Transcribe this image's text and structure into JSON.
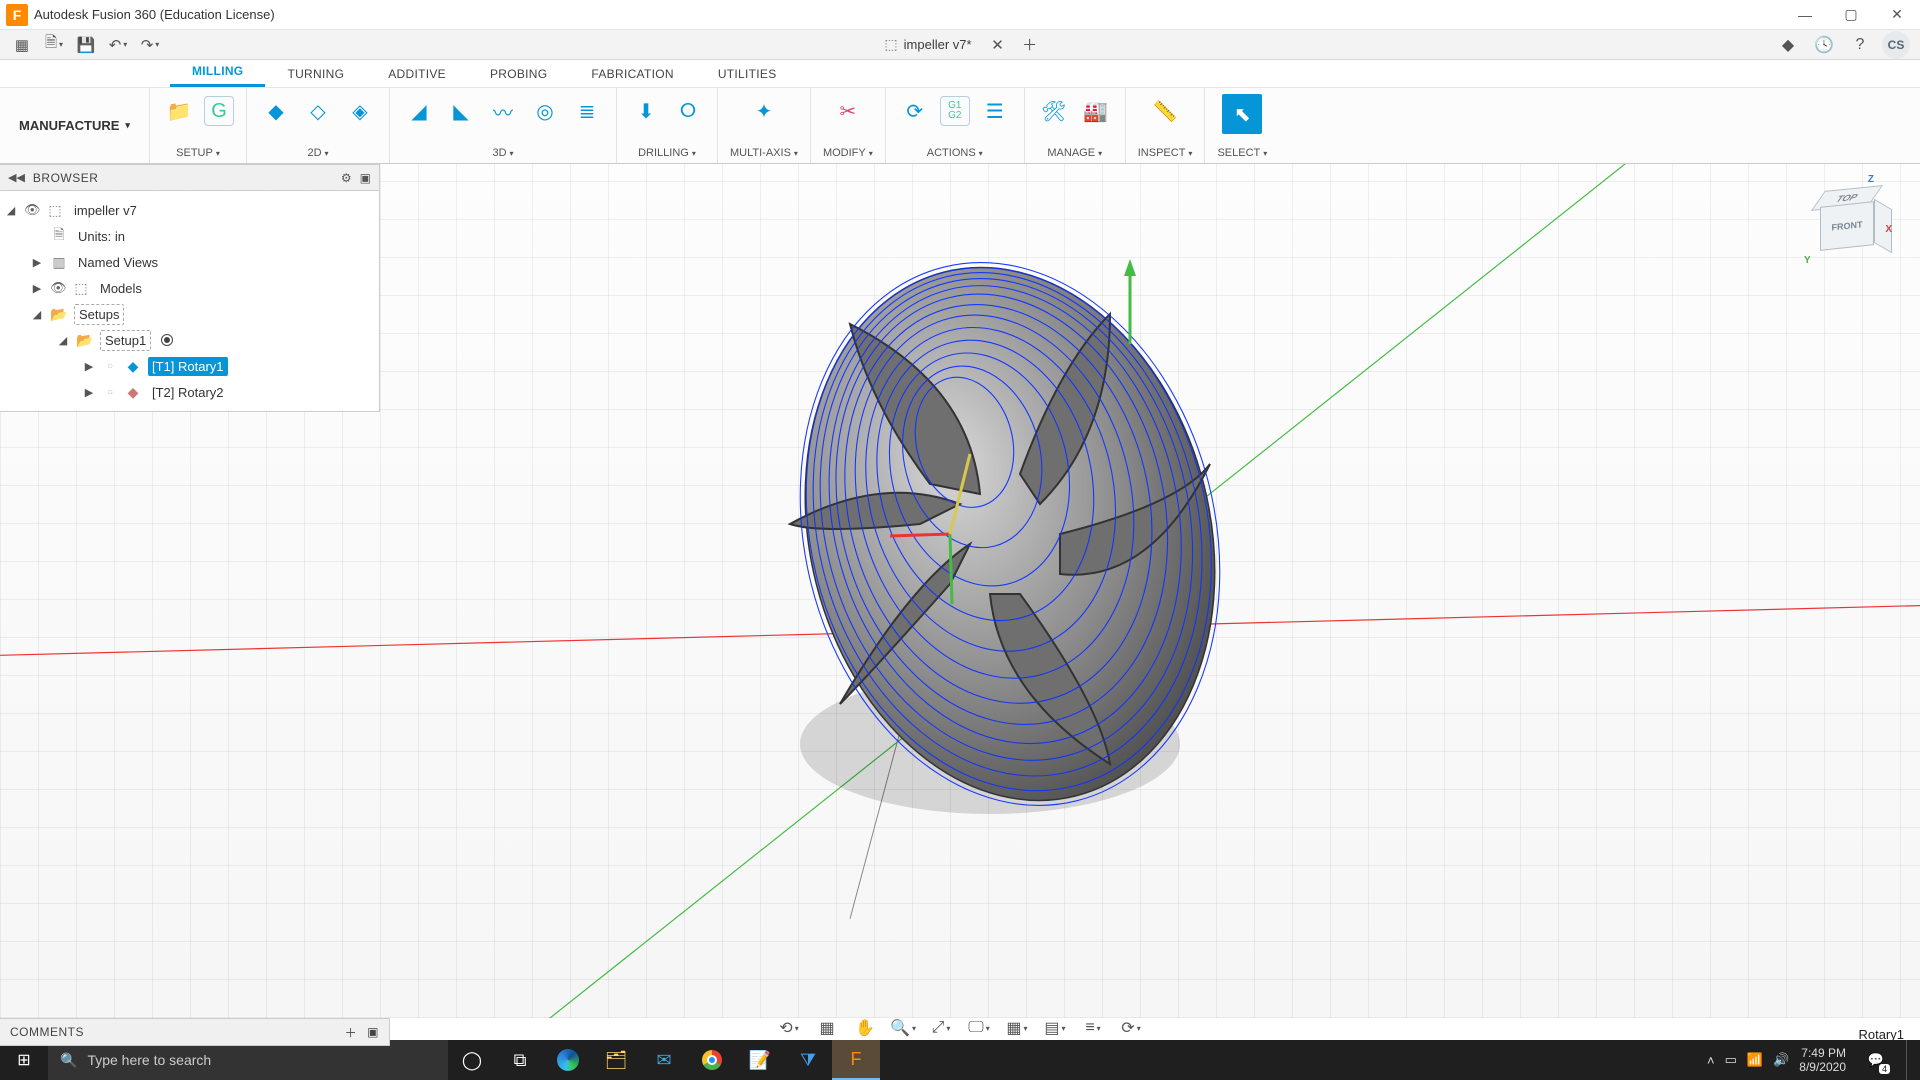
{
  "title_bar": {
    "app_title": "Autodesk Fusion 360 (Education License)",
    "app_logo_letter": "F"
  },
  "doc_tab": {
    "name": "impeller v7*"
  },
  "user_initials": "CS",
  "workspace": "MANUFACTURE",
  "ribbon_tabs": [
    "MILLING",
    "TURNING",
    "ADDITIVE",
    "PROBING",
    "FABRICATION",
    "UTILITIES"
  ],
  "ribbon_active_tab": "MILLING",
  "ribbon_groups": {
    "setup": "SETUP",
    "twod": "2D",
    "threed": "3D",
    "drilling": "DRILLING",
    "multiaxis": "MULTI-AXIS",
    "modify": "MODIFY",
    "actions": "ACTIONS",
    "manage": "MANAGE",
    "inspect": "INSPECT",
    "select": "SELECT"
  },
  "browser": {
    "title": "BROWSER",
    "root": "impeller v7",
    "items": [
      {
        "label": "Units: in"
      },
      {
        "label": "Named Views"
      },
      {
        "label": "Models"
      },
      {
        "label": "Setups"
      },
      {
        "label": "Setup1"
      },
      {
        "label": "[T1] Rotary1"
      },
      {
        "label": "[T2] Rotary2"
      }
    ]
  },
  "viewcube": {
    "top": "TOP",
    "front": "FRONT",
    "x": "X",
    "y": "Y",
    "z": "Z"
  },
  "comments": {
    "title": "COMMENTS"
  },
  "status_right": "Rotary1",
  "taskbar": {
    "search_placeholder": "Type here to search",
    "time": "7:49 PM",
    "date": "8/9/2020",
    "notif_count": "4"
  }
}
